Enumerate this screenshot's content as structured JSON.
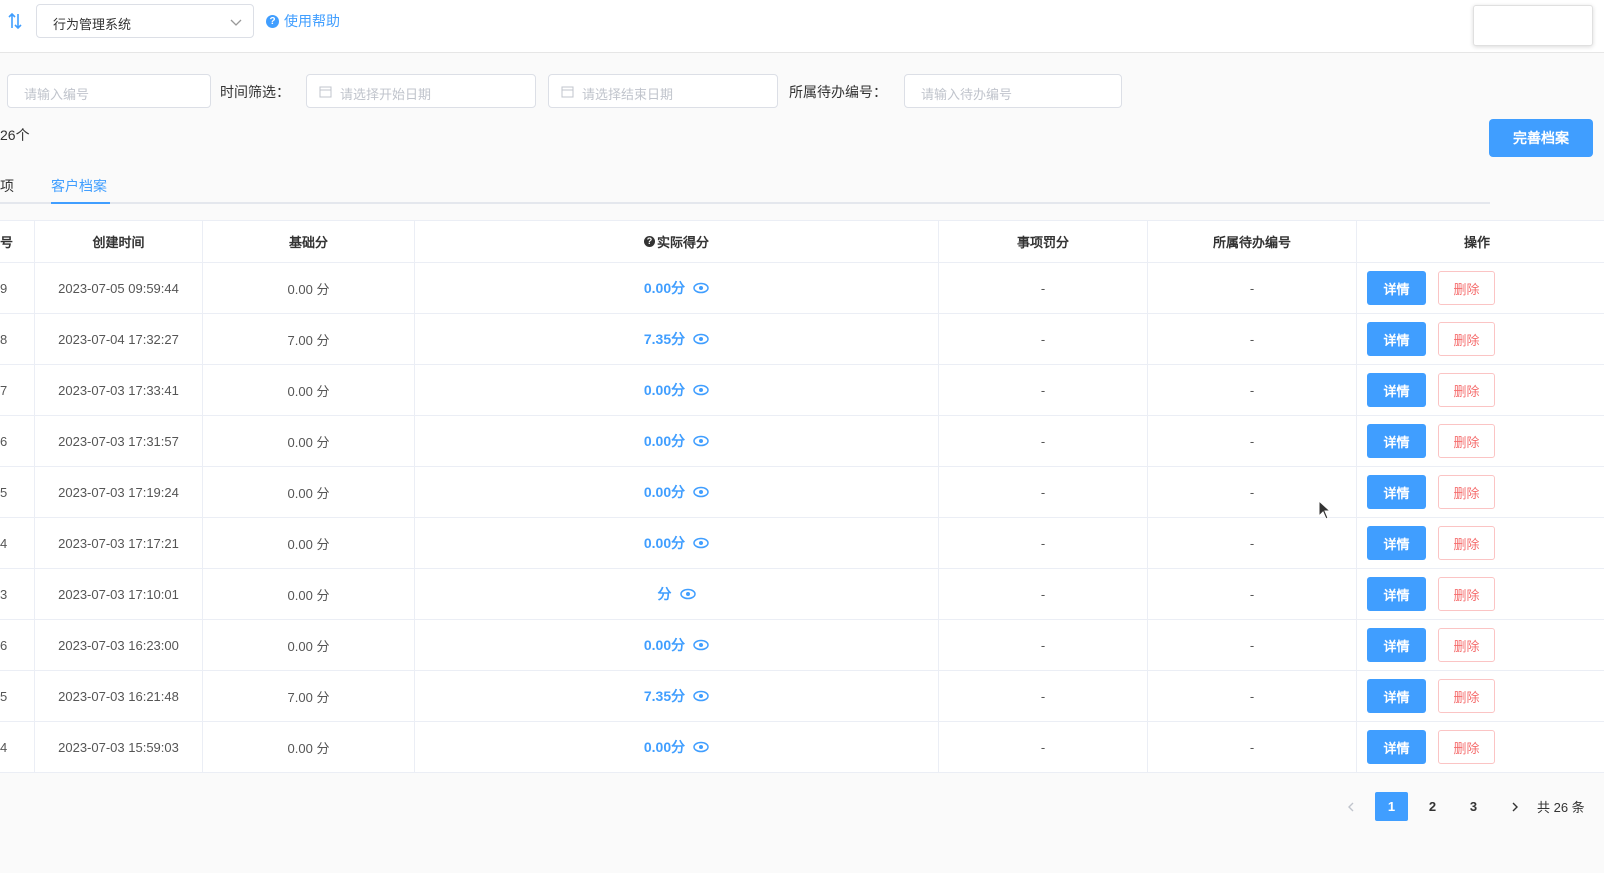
{
  "header": {
    "system_select": "行为管理系统",
    "help_label": "使用帮助"
  },
  "filters": {
    "number_placeholder": "请输入编号",
    "time_label": "时间筛选：",
    "start_placeholder": "请选择开始日期",
    "end_placeholder": "请选择结束日期",
    "todo_label": "所属待办编号：",
    "todo_placeholder": "请输入待办编号"
  },
  "count_text": "26个",
  "complete_button": "完善档案",
  "tabs": [
    {
      "label": "项"
    },
    {
      "label": "客户档案",
      "active": true
    }
  ],
  "table": {
    "headers": [
      "号",
      "创建时间",
      "基础分",
      "实际得分",
      "事项罚分",
      "所属待办编号",
      "操作"
    ],
    "rows": [
      {
        "id": "9",
        "created": "2023-07-05 09:59:44",
        "base": "0.00 分",
        "actual": "0.00分",
        "penalty": "-",
        "todo": "-"
      },
      {
        "id": "8",
        "created": "2023-07-04 17:32:27",
        "base": "7.00 分",
        "actual": "7.35分",
        "penalty": "-",
        "todo": "-"
      },
      {
        "id": "7",
        "created": "2023-07-03 17:33:41",
        "base": "0.00 分",
        "actual": "0.00分",
        "penalty": "-",
        "todo": "-"
      },
      {
        "id": "6",
        "created": "2023-07-03 17:31:57",
        "base": "0.00 分",
        "actual": "0.00分",
        "penalty": "-",
        "todo": "-"
      },
      {
        "id": "5",
        "created": "2023-07-03 17:19:24",
        "base": "0.00 分",
        "actual": "0.00分",
        "penalty": "-",
        "todo": "-"
      },
      {
        "id": "4",
        "created": "2023-07-03 17:17:21",
        "base": "0.00 分",
        "actual": "0.00分",
        "penalty": "-",
        "todo": "-"
      },
      {
        "id": "3",
        "created": "2023-07-03 17:10:01",
        "base": "0.00 分",
        "actual": "分",
        "penalty": "-",
        "todo": "-"
      },
      {
        "id": "6",
        "created": "2023-07-03 16:23:00",
        "base": "0.00 分",
        "actual": "0.00分",
        "penalty": "-",
        "todo": "-"
      },
      {
        "id": "5",
        "created": "2023-07-03 16:21:48",
        "base": "7.00 分",
        "actual": "7.35分",
        "penalty": "-",
        "todo": "-"
      },
      {
        "id": "4",
        "created": "2023-07-03 15:59:03",
        "base": "0.00 分",
        "actual": "0.00分",
        "penalty": "-",
        "todo": "-"
      }
    ],
    "detail_label": "详情",
    "delete_label": "删除"
  },
  "pagination": {
    "pages": [
      "1",
      "2",
      "3"
    ],
    "current": "1",
    "total_text": "共 26 条"
  },
  "colors": {
    "primary": "#409eff",
    "danger": "#f56c6c"
  },
  "icons": [
    "collapse-icon",
    "chevron-down-icon",
    "help-icon",
    "calendar-icon",
    "eye-icon",
    "question-icon",
    "chevron-left-icon",
    "chevron-right-icon",
    "cursor-icon"
  ]
}
